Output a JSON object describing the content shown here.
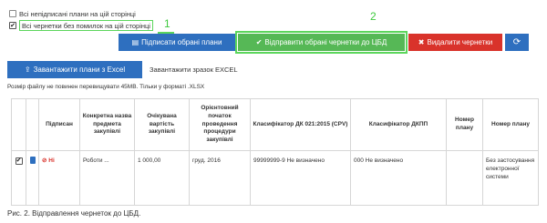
{
  "checkboxes": [
    {
      "label": "Всі непідписані плани на цій сторінці",
      "checked": false
    },
    {
      "label": "Всі чернетки без помилок на цій сторінці",
      "checked": true
    }
  ],
  "annotations": [
    "1",
    "2"
  ],
  "actions": {
    "sign_label": "Підписати обрані плани",
    "send_label": "Відправити обрані чернетки до ЦБД",
    "delete_label": "Видалити чернетки",
    "refresh_icon": "refresh-icon"
  },
  "upload": {
    "button_label": "Завантажити плани з Excel",
    "sample_label": "Завантажити зразок EXCEL",
    "note": "Розмір файлу не повинен перевищувати 45МВ. Тільки у форматі .XLSX"
  },
  "table": {
    "headers": [
      "",
      "",
      "Підписан",
      "Конкретна назва предмета закупівлі",
      "Очікувана вартість закупівлі",
      "Орієнтовний початок проведення процедури закупівлі",
      "Класифікатор ДК 021:2015 (CPV)",
      "Класифікатор ДКПП",
      "Номер плану",
      "Номер плану"
    ],
    "rows": [
      {
        "checked": true,
        "signed": "Ні",
        "name": "Роботи ...",
        "amount": "1 000,00",
        "start": "груд. 2016",
        "cpv": "99999999-9 Не визначено",
        "dkpp": "000 Не визначено",
        "plan_no": "",
        "plan_no2": "Без застосування електронної системи"
      }
    ]
  },
  "caption": "Рис. 2. Відправлення чернеток до ЦБД.",
  "colors": {
    "primary": "#2e6fbf",
    "success": "#56b856",
    "danger": "#d9332b",
    "annotation": "#5cd65c"
  }
}
